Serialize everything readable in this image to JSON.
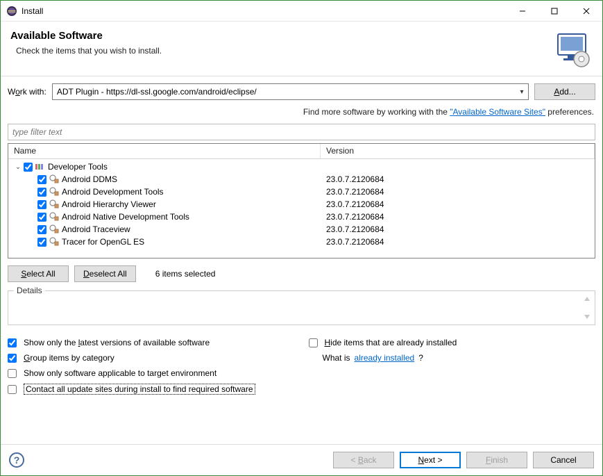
{
  "window": {
    "title": "Install"
  },
  "header": {
    "title": "Available Software",
    "subtitle": "Check the items that you wish to install."
  },
  "workwith": {
    "label_pre": "W",
    "label_u": "o",
    "label_post": "rk with:",
    "value": "ADT Plugin - https://dl-ssl.google.com/android/eclipse/",
    "add_pre": "",
    "add_u": "A",
    "add_post": "dd..."
  },
  "hint": {
    "pre": "Find more software by working with the ",
    "link": "\"Available Software Sites\"",
    "post": " preferences."
  },
  "filter": {
    "placeholder": "type filter text"
  },
  "columns": {
    "name": "Name",
    "version": "Version"
  },
  "tree": {
    "category": "Developer Tools",
    "items": [
      {
        "name": "Android DDMS",
        "version": "23.0.7.2120684"
      },
      {
        "name": "Android Development Tools",
        "version": "23.0.7.2120684"
      },
      {
        "name": "Android Hierarchy Viewer",
        "version": "23.0.7.2120684"
      },
      {
        "name": "Android Native Development Tools",
        "version": "23.0.7.2120684"
      },
      {
        "name": "Android Traceview",
        "version": "23.0.7.2120684"
      },
      {
        "name": "Tracer for OpenGL ES",
        "version": "23.0.7.2120684"
      }
    ]
  },
  "selection": {
    "select_all_u": "S",
    "select_all_post": "elect All",
    "deselect_all_u": "D",
    "deselect_all_post": "eselect All",
    "count_label": "6 items selected"
  },
  "details_label": "Details",
  "opts": {
    "o1_pre": "Show only the ",
    "o1_u": "l",
    "o1_post": "atest versions of available software",
    "o2_u": "H",
    "o2_post": "ide items that are already installed",
    "o3_u": "G",
    "o3_post": "roup items by category",
    "o4_pre": "What is ",
    "o4_link": "already installed",
    "o4_post": "?",
    "o5": "Show only software applicable to target environment",
    "o6": "Contact all update sites during install to find required software"
  },
  "footer": {
    "back_pre": "< ",
    "back_u": "B",
    "back_post": "ack",
    "next_u": "N",
    "next_post": "ext >",
    "finish_u": "F",
    "finish_post": "inish",
    "cancel": "Cancel"
  }
}
